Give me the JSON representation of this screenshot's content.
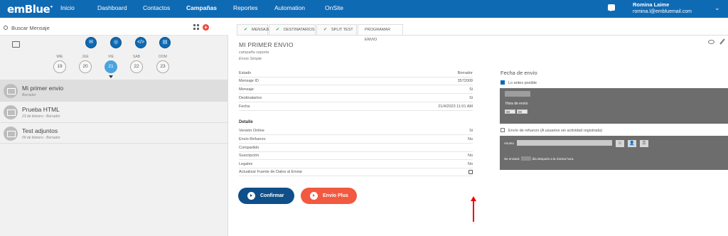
{
  "app": {
    "logo": "emBlue",
    "logo_mark": "•"
  },
  "nav": [
    "Inicio",
    "Dashboard",
    "Contactos",
    "Campañas",
    "Reportes",
    "Automation",
    "OnSite"
  ],
  "user": {
    "name": "Romina Laime",
    "email": "romina.l@embluemail.com"
  },
  "sidebar": {
    "search_placeholder": "Buscar Mensaje",
    "days": [
      {
        "dow": "MIE",
        "num": "19"
      },
      {
        "dow": "JUE",
        "num": "20"
      },
      {
        "dow": "VIE",
        "num": "21"
      },
      {
        "dow": "SAB",
        "num": "22"
      },
      {
        "dow": "DOM",
        "num": "23"
      }
    ],
    "messages": [
      {
        "title": "Mi primer envio",
        "subtitle": "Borrador"
      },
      {
        "title": "Prueba HTML",
        "subtitle": "23 de febrero - Borrador"
      },
      {
        "title": "Test adjuntos",
        "subtitle": "09 de febrero - Borrador"
      }
    ]
  },
  "tabs": [
    "MENSAJE",
    "DESTINATARIOS",
    "SPLIT TEST",
    "PROGRAMAR ENVIO"
  ],
  "message": {
    "title": "MI PRIMER ENVIO",
    "campaign": "campaña soporte",
    "type": "Envio Simple",
    "rows": [
      {
        "label": "Estado",
        "value": "Borrador"
      },
      {
        "label": "Mensaje ID",
        "value": "3572009"
      },
      {
        "label": "Mensaje",
        "value": "Si"
      },
      {
        "label": "Destinatarios",
        "value": "Si"
      },
      {
        "label": "Fecha",
        "value": "21/4/2023 11:01 AM"
      }
    ],
    "detail_title": "Detalle",
    "detail_rows": [
      {
        "label": "Versión Online",
        "value": "Si"
      },
      {
        "label": "Envio Refuerzo",
        "value": "No"
      },
      {
        "label": "Compartido",
        "value": ""
      },
      {
        "label": "Suscripción",
        "value": "No"
      },
      {
        "label": "Legales",
        "value": "No"
      },
      {
        "label": "Actualizar Fuente de Datos al Enviar",
        "value": ""
      }
    ],
    "confirm_label": "Confirmar",
    "plus_label": "Envio Plus"
  },
  "schedule": {
    "title": "Fecha de envío",
    "asap_label": "Lo antes posible",
    "hour_label": "Hora de envío",
    "hour_value": "00",
    "minute_value": "00",
    "refuerzo_label": "Envío de refuerzo (A usuarios sin actividad registrada)",
    "subject_label": "Asunto",
    "send_text_before": "Se enviará",
    "send_text_after": "día después a la misma hora."
  }
}
